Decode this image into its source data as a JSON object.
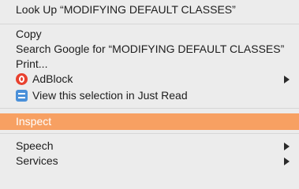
{
  "menu": {
    "look_up": "Look Up “MODIFYING DEFAULT CLASSES”",
    "copy": "Copy",
    "search_google": "Search Google for “MODIFYING DEFAULT CLASSES”",
    "print": "Print...",
    "adblock": "AdBlock",
    "just_read": "View this selection in Just Read",
    "inspect": "Inspect",
    "speech": "Speech",
    "services": "Services"
  },
  "icons": {
    "adblock": "adblock-icon",
    "just_read": "just-read-icon",
    "submenu_arrow": "chevron-right-icon"
  },
  "colors": {
    "menu_background": "#ececec",
    "highlight": "#f7a062",
    "highlight_text": "#ffffff",
    "adblock_red": "#e8412f",
    "just_read_blue": "#4a90d9"
  }
}
